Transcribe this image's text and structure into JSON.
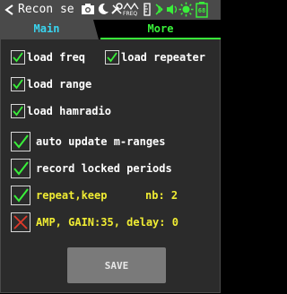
{
  "titlebar": {
    "title": "Recon se",
    "freq_icon_label": "FREQ",
    "battery_label": "68",
    "icons": [
      "back-arrow-icon",
      "camera-icon",
      "moon-icon",
      "tools-icon",
      "freq-icon",
      "ruler-icon",
      "wifi-icon",
      "volume-icon",
      "sun-icon",
      "battery-icon"
    ]
  },
  "tabs": [
    {
      "label": "Main",
      "active": true,
      "color": "#39d5f0"
    },
    {
      "label": "More",
      "active": false,
      "color": "#39f03a"
    }
  ],
  "options": {
    "load_freq": {
      "label": "load freq",
      "checked": true
    },
    "load_repeater": {
      "label": "load repeater",
      "checked": true
    },
    "load_range": {
      "label": "load range",
      "checked": true
    },
    "load_hamradio": {
      "label": "load hamradio",
      "checked": true
    },
    "auto_update": {
      "label": "auto update m-ranges",
      "checked": true
    },
    "record_locked": {
      "label": "record locked periods",
      "checked": true
    },
    "repeat_keep": {
      "label": "repeat,keep",
      "nb_label": "nb: 2",
      "checked": true
    },
    "amp_gain": {
      "label": "AMP, GAIN:35, delay:  0",
      "checked": false
    }
  },
  "colors": {
    "check_green": "#39f03a",
    "cross_red": "#e03a2b",
    "highlight_yellow": "#f0ec33",
    "panel_bg": "#2b2b2b"
  },
  "save_button": {
    "label": "SAVE"
  }
}
